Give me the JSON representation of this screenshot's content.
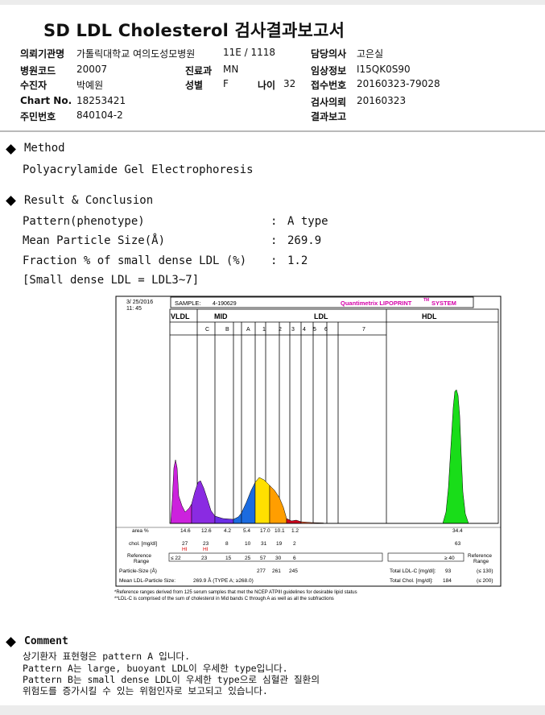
{
  "title": "SD LDL Cholesterol 검사결과보고서",
  "info": {
    "institution_label": "의뢰기관명",
    "institution": "가톨릭대학교 여의도성모병원",
    "ward": "11E / 1118",
    "doctor_label": "담당의사",
    "doctor": "고은실",
    "hospital_code_label": "병원코드",
    "hospital_code": "20007",
    "dept_label": "진료과",
    "dept": "MN",
    "clinical_label": "임상정보",
    "clinical": "I15QK0S90",
    "patient_label": "수진자",
    "patient": "박예원",
    "sex_label": "성별",
    "sex": "F",
    "age_label": "나이",
    "age": "32",
    "receipt_label": "접수번호",
    "receipt": "20160323-79028",
    "chart_label": "Chart No.",
    "chart_no": "18253421",
    "request_label": "검사의뢰",
    "request": "20160323",
    "resident_label": "주민번호",
    "resident": "840104-2",
    "report_label": "결과보고"
  },
  "method": {
    "heading": "Method",
    "text": "Polyacrylamide Gel Electrophoresis"
  },
  "result": {
    "heading": "Result & Conclusion",
    "rows": [
      {
        "label": "Pattern(phenotype)",
        "value": "A type"
      },
      {
        "label": "Mean Particle Size(Å)",
        "value": "269.9"
      },
      {
        "label": "Fraction % of small dense LDL (%)",
        "value": "1.2"
      }
    ],
    "note": "[Small dense LDL = LDL3~7]"
  },
  "chart_data": {
    "type": "area",
    "date": "3/ 25/2016",
    "time": "11: 45",
    "sample_label": "SAMPLE:",
    "sample": "4-190629",
    "brand": "Quantimetrix LIPOPRINT",
    "brand_tm": "TM",
    "brand_system": "SYSTEM",
    "groups": [
      "VLDL",
      "MID",
      "LDL",
      "HDL"
    ],
    "bands": [
      "C",
      "B",
      "A",
      "1",
      "2",
      "3",
      "4",
      "5",
      "6",
      "7"
    ],
    "rows": {
      "area_label": "area %",
      "area": [
        "14.6",
        "12.6",
        "4.2",
        "5.4",
        "17.0",
        "10.1",
        "1.2",
        "34.4"
      ],
      "chol_label": "chol. [mg/dl]",
      "chol": [
        "27",
        "23",
        "8",
        "10",
        "31",
        "19",
        "2",
        "63"
      ],
      "hi": [
        "HI",
        "HI"
      ],
      "ref_label": "Reference Range",
      "ref": [
        "≤ 22",
        "23",
        "15",
        "25",
        "57",
        "30",
        "6"
      ],
      "hdl_ref": "≥ 40",
      "right_ref_label": "Reference Range",
      "ps_label": "Particle-Size (Å)",
      "ps": [
        "277",
        "261",
        "245"
      ],
      "mean_label": "Mean LDL-Particle Size:",
      "mean": "269.9 Å   (TYPE A; ≥268.0)",
      "total_ldl_label": "Total LDL-C [mg/dl]:",
      "total_ldl": "93",
      "total_ldl_ref": "(≤ 130)",
      "total_chol_label": "Total Chol. [mg/dl]:",
      "total_chol": "184",
      "total_chol_ref": "(≤ 200)"
    },
    "footnote1": "*Reference ranges derived from 125 serum samples that met the NCEP ATPIII guidelines for desirable lipid status",
    "footnote2": "**LDL-C is comprised of the sum of cholesterol in Mid bands C through A as well as all the subfractions",
    "colors": {
      "vldl": "#cc22dd",
      "c": "#8a2be2",
      "b": "#6b2ee6",
      "a": "#1b6be0",
      "ldl1": "#ffe000",
      "ldl2": "#ff9e00",
      "ldl3": "#ff6030",
      "ldl4": "#d0001c",
      "hdl": "#19dd19",
      "brand": "#d400a8",
      "hi": "#dd0000"
    }
  },
  "comment": {
    "heading": "Comment",
    "lines": [
      "상기환자 표현형은 pattern A 입니다.",
      "Pattern A는 large, buoyant LDL이 우세한 type입니다.",
      "Pattern B는 small dense LDL이 우세한 type으로 심혈관 질환의",
      "위험도를 증가시킬 수 있는 위험인자로 보고되고 있습니다."
    ]
  }
}
